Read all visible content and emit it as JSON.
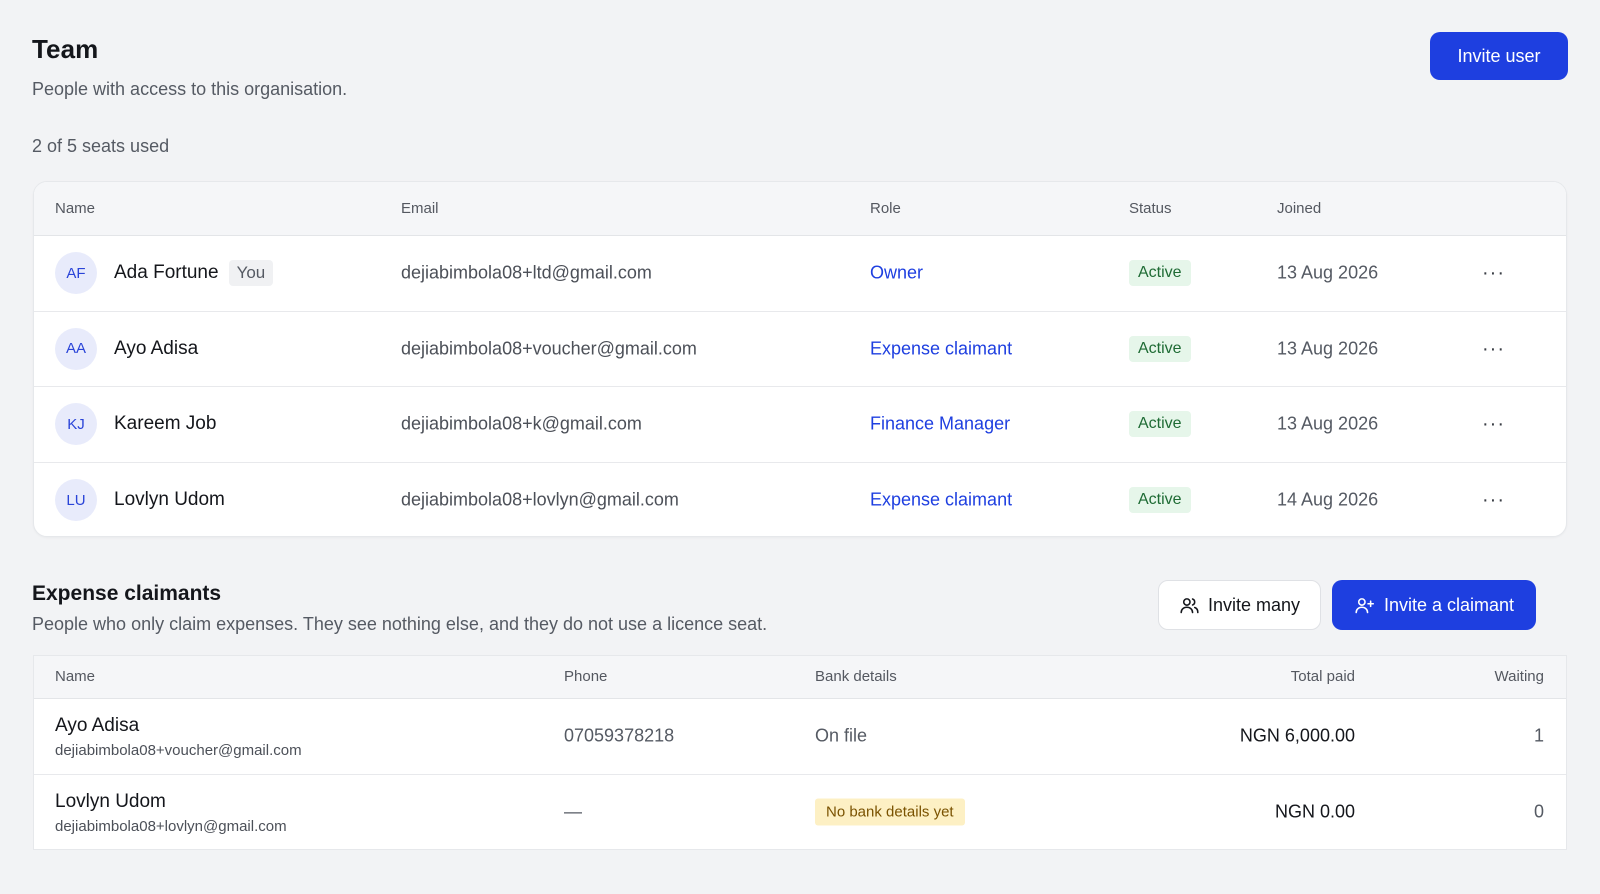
{
  "header": {
    "title": "Team",
    "subtitle": "People with access to this organisation.",
    "invite_button": "Invite user"
  },
  "seats": "2 of 5 seats used",
  "team_table": {
    "columns": [
      "Name",
      "Email",
      "Role",
      "Status",
      "Joined"
    ],
    "you_tag": "You",
    "rows": [
      {
        "initials": "AF",
        "name": "Ada Fortune",
        "email": "dejiabimbola08+ltd@gmail.com",
        "role": "Owner",
        "status": "Active",
        "joined": "13 Aug 2026",
        "more": "···"
      },
      {
        "initials": "AA",
        "name": "Ayo Adisa",
        "email": "dejiabimbola08+voucher@gmail.com",
        "role": "Expense claimant",
        "status": "Active",
        "joined": "13 Aug 2026",
        "more": "···"
      },
      {
        "initials": "KJ",
        "name": "Kareem Job",
        "email": "dejiabimbola08+k@gmail.com",
        "role": "Finance Manager",
        "status": "Active",
        "joined": "13 Aug 2026",
        "more": "···"
      },
      {
        "initials": "LU",
        "name": "Lovlyn Udom",
        "email": "dejiabimbola08+lovlyn@gmail.com",
        "role": "Expense claimant",
        "status": "Active",
        "joined": "14 Aug 2026",
        "more": "···"
      }
    ]
  },
  "claimants": {
    "title": "Expense claimants",
    "subtitle": "People who only claim expenses. They see nothing else, and they do not use a licence seat.",
    "invite_many": "Invite many",
    "invite_claimant": "Invite a claimant",
    "columns": [
      "Name",
      "Phone",
      "Bank details",
      "Total paid",
      "Waiting"
    ],
    "rows": [
      {
        "name": "Ayo Adisa",
        "email": "dejiabimbola08+voucher@gmail.com",
        "phone": "07059378218",
        "bank": "On file",
        "total_paid": "NGN 6,000.00",
        "waiting": "1"
      },
      {
        "name": "Lovlyn Udom",
        "email": "dejiabimbola08+lovlyn@gmail.com",
        "phone": "—",
        "bank": "No bank details yet",
        "total_paid": "NGN 0.00",
        "waiting": "0"
      }
    ]
  },
  "colors": {
    "primary": "#1e3fe0",
    "active_bg": "#e6f6ea",
    "active_text": "#1e6b34",
    "warn_bg": "#fdf0c4"
  },
  "icons": [
    "users-icon",
    "user-plus-icon",
    "more-icon"
  ]
}
